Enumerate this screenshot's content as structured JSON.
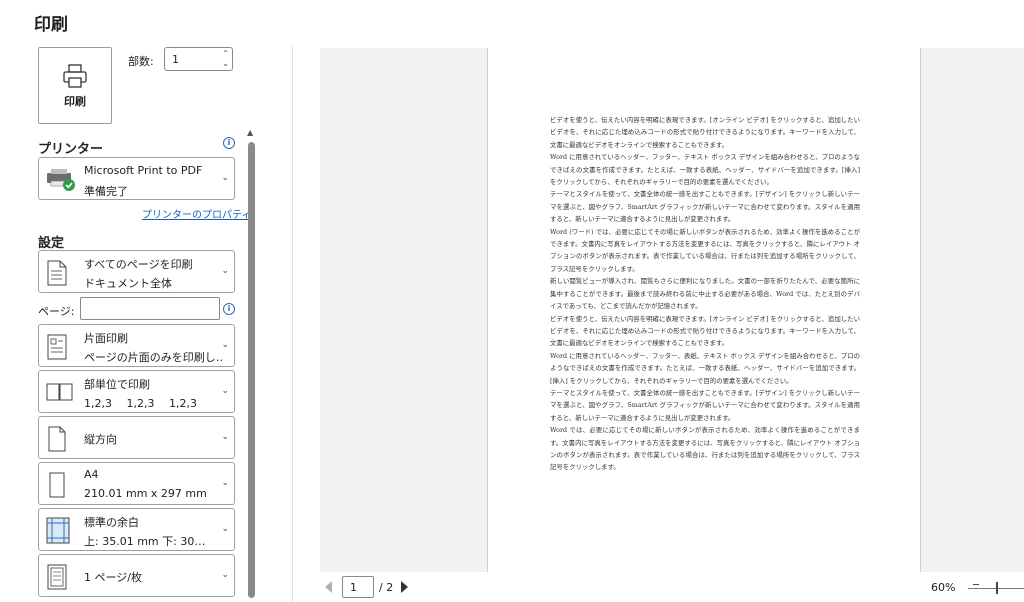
{
  "title": "印刷",
  "print_button": {
    "label": "印刷",
    "icon": "printer-icon"
  },
  "copies": {
    "label": "部数:",
    "value": "1"
  },
  "printer": {
    "section_label": "プリンター",
    "name": "Microsoft Print to PDF",
    "status": "準備完了",
    "properties_link": "プリンターのプロパティ"
  },
  "settings": {
    "section_label": "設定",
    "range": {
      "line1": "すべてのページを印刷",
      "line2": "ドキュメント全体"
    },
    "pages": {
      "label": "ページ:",
      "value": ""
    },
    "sides": {
      "line1": "片面印刷",
      "line2": "ページの片面のみを印刷し…"
    },
    "collate": {
      "line1": "部単位で印刷",
      "line2": "1,2,3　 1,2,3　 1,2,3"
    },
    "orientation": {
      "line1": "縦方向"
    },
    "paper": {
      "line1": "A4",
      "line2": "210.01 mm x 297 mm"
    },
    "margins": {
      "line1": "標準の余白",
      "line2": "上: 35.01 mm 下: 30…"
    },
    "per_sheet": {
      "line1": "1 ページ/枚"
    }
  },
  "preview": {
    "paragraphs": [
      "ビデオを使うと、伝えたい内容を明確に表現できます。[オンライン ビデオ] をクリックすると、追加したいビデオを、それに応じた埋め込みコードの形式で貼り付けできるようになります。キーワードを入力して、文書に最適なビデオをオンラインで検索することもできます。",
      "Word に用意されているヘッダー、フッター、テキスト ボックス デザインを組み合わせると、プロのようなできばえの文書を作成できます。たとえば、一致する表紙、ヘッダー、サイドバーを追加できます。[挿入] をクリックしてから、それぞれのギャラリーで目的の要素を選んでください。",
      "テーマとスタイルを使って、文書全体の統一感を出すこともできます。[デザイン] をクリックし新しいテーマを選ぶと、図やグラフ、SmartArt グラフィックが新しいテーマに合わせて変わります。スタイルを適用すると、新しいテーマに適合するように見出しが変更されます。",
      "Word (ワード) では、必要に応じてその場に新しいボタンが表示されるため、効率よく操作を進めることができます。文書内に写真をレイアウトする方法を変更するには、写真をクリックすると、隣にレイアウト オプションのボタンが表示されます。表で作業している場合は、行または列を追加する場所をクリックして、プラス記号をクリックします。",
      "新しい閲覧ビューが導入され、閲覧もさらに便利になりました。文書の一部を折りたたんで、必要な箇所に集中することができます。最後まで読み終わる前に中止する必要がある場合、Word では、たとえ別のデバイスであっても、どこまで読んだかが記憶されます。",
      "ビデオを使うと、伝えたい内容を明確に表現できます。[オンライン ビデオ] をクリックすると、追加したいビデオを、それに応じた埋め込みコードの形式で貼り付けできるようになります。キーワードを入力して、文書に最適なビデオをオンラインで検索することもできます。",
      "Word に用意されているヘッダー、フッター、表紙、テキスト ボックス デザインを組み合わせると、プロのようなできばえの文書を作成できます。たとえば、一致する表紙、ヘッダー、サイドバーを追加できます。[挿入] をクリックしてから、それぞれのギャラリーで目的の要素を選んでください。",
      "テーマとスタイルを使って、文書全体の統一感を出すこともできます。[デザイン] をクリックし新しいテーマを選ぶと、図やグラフ、SmartArt グラフィックが新しいテーマに合わせて変わります。スタイルを適用すると、新しいテーマに適合するように見出しが変更されます。",
      "Word では、必要に応じてその場に新しいボタンが表示されるため、効率よく操作を進めることができます。文書内に写真をレイアウトする方法を変更するには、写真をクリックすると、隣にレイアウト オプションのボタンが表示されます。表で作業している場合は、行または列を追加する場所をクリックして、プラス記号をクリックします。"
    ]
  },
  "pager": {
    "current": "1",
    "total": "/ 2"
  },
  "zoom": {
    "label": "60%"
  }
}
